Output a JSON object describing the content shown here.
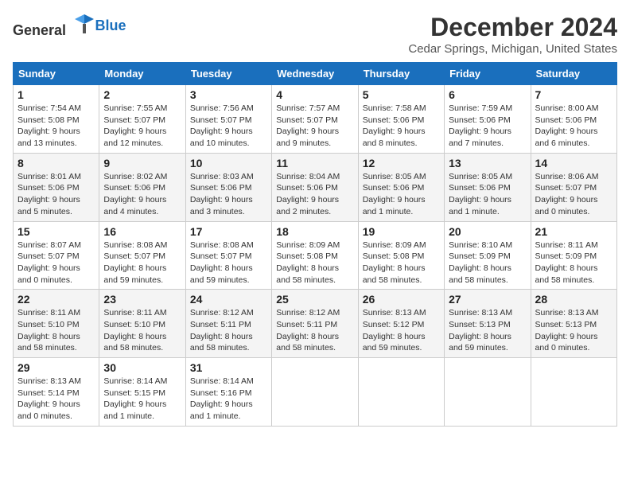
{
  "header": {
    "logo_general": "General",
    "logo_blue": "Blue",
    "month": "December 2024",
    "location": "Cedar Springs, Michigan, United States"
  },
  "days_of_week": [
    "Sunday",
    "Monday",
    "Tuesday",
    "Wednesday",
    "Thursday",
    "Friday",
    "Saturday"
  ],
  "weeks": [
    [
      {
        "day": "1",
        "sunrise": "Sunrise: 7:54 AM",
        "sunset": "Sunset: 5:08 PM",
        "daylight": "Daylight: 9 hours and 13 minutes."
      },
      {
        "day": "2",
        "sunrise": "Sunrise: 7:55 AM",
        "sunset": "Sunset: 5:07 PM",
        "daylight": "Daylight: 9 hours and 12 minutes."
      },
      {
        "day": "3",
        "sunrise": "Sunrise: 7:56 AM",
        "sunset": "Sunset: 5:07 PM",
        "daylight": "Daylight: 9 hours and 10 minutes."
      },
      {
        "day": "4",
        "sunrise": "Sunrise: 7:57 AM",
        "sunset": "Sunset: 5:07 PM",
        "daylight": "Daylight: 9 hours and 9 minutes."
      },
      {
        "day": "5",
        "sunrise": "Sunrise: 7:58 AM",
        "sunset": "Sunset: 5:06 PM",
        "daylight": "Daylight: 9 hours and 8 minutes."
      },
      {
        "day": "6",
        "sunrise": "Sunrise: 7:59 AM",
        "sunset": "Sunset: 5:06 PM",
        "daylight": "Daylight: 9 hours and 7 minutes."
      },
      {
        "day": "7",
        "sunrise": "Sunrise: 8:00 AM",
        "sunset": "Sunset: 5:06 PM",
        "daylight": "Daylight: 9 hours and 6 minutes."
      }
    ],
    [
      {
        "day": "8",
        "sunrise": "Sunrise: 8:01 AM",
        "sunset": "Sunset: 5:06 PM",
        "daylight": "Daylight: 9 hours and 5 minutes."
      },
      {
        "day": "9",
        "sunrise": "Sunrise: 8:02 AM",
        "sunset": "Sunset: 5:06 PM",
        "daylight": "Daylight: 9 hours and 4 minutes."
      },
      {
        "day": "10",
        "sunrise": "Sunrise: 8:03 AM",
        "sunset": "Sunset: 5:06 PM",
        "daylight": "Daylight: 9 hours and 3 minutes."
      },
      {
        "day": "11",
        "sunrise": "Sunrise: 8:04 AM",
        "sunset": "Sunset: 5:06 PM",
        "daylight": "Daylight: 9 hours and 2 minutes."
      },
      {
        "day": "12",
        "sunrise": "Sunrise: 8:05 AM",
        "sunset": "Sunset: 5:06 PM",
        "daylight": "Daylight: 9 hours and 1 minute."
      },
      {
        "day": "13",
        "sunrise": "Sunrise: 8:05 AM",
        "sunset": "Sunset: 5:06 PM",
        "daylight": "Daylight: 9 hours and 1 minute."
      },
      {
        "day": "14",
        "sunrise": "Sunrise: 8:06 AM",
        "sunset": "Sunset: 5:07 PM",
        "daylight": "Daylight: 9 hours and 0 minutes."
      }
    ],
    [
      {
        "day": "15",
        "sunrise": "Sunrise: 8:07 AM",
        "sunset": "Sunset: 5:07 PM",
        "daylight": "Daylight: 9 hours and 0 minutes."
      },
      {
        "day": "16",
        "sunrise": "Sunrise: 8:08 AM",
        "sunset": "Sunset: 5:07 PM",
        "daylight": "Daylight: 8 hours and 59 minutes."
      },
      {
        "day": "17",
        "sunrise": "Sunrise: 8:08 AM",
        "sunset": "Sunset: 5:07 PM",
        "daylight": "Daylight: 8 hours and 59 minutes."
      },
      {
        "day": "18",
        "sunrise": "Sunrise: 8:09 AM",
        "sunset": "Sunset: 5:08 PM",
        "daylight": "Daylight: 8 hours and 58 minutes."
      },
      {
        "day": "19",
        "sunrise": "Sunrise: 8:09 AM",
        "sunset": "Sunset: 5:08 PM",
        "daylight": "Daylight: 8 hours and 58 minutes."
      },
      {
        "day": "20",
        "sunrise": "Sunrise: 8:10 AM",
        "sunset": "Sunset: 5:09 PM",
        "daylight": "Daylight: 8 hours and 58 minutes."
      },
      {
        "day": "21",
        "sunrise": "Sunrise: 8:11 AM",
        "sunset": "Sunset: 5:09 PM",
        "daylight": "Daylight: 8 hours and 58 minutes."
      }
    ],
    [
      {
        "day": "22",
        "sunrise": "Sunrise: 8:11 AM",
        "sunset": "Sunset: 5:10 PM",
        "daylight": "Daylight: 8 hours and 58 minutes."
      },
      {
        "day": "23",
        "sunrise": "Sunrise: 8:11 AM",
        "sunset": "Sunset: 5:10 PM",
        "daylight": "Daylight: 8 hours and 58 minutes."
      },
      {
        "day": "24",
        "sunrise": "Sunrise: 8:12 AM",
        "sunset": "Sunset: 5:11 PM",
        "daylight": "Daylight: 8 hours and 58 minutes."
      },
      {
        "day": "25",
        "sunrise": "Sunrise: 8:12 AM",
        "sunset": "Sunset: 5:11 PM",
        "daylight": "Daylight: 8 hours and 58 minutes."
      },
      {
        "day": "26",
        "sunrise": "Sunrise: 8:13 AM",
        "sunset": "Sunset: 5:12 PM",
        "daylight": "Daylight: 8 hours and 59 minutes."
      },
      {
        "day": "27",
        "sunrise": "Sunrise: 8:13 AM",
        "sunset": "Sunset: 5:13 PM",
        "daylight": "Daylight: 8 hours and 59 minutes."
      },
      {
        "day": "28",
        "sunrise": "Sunrise: 8:13 AM",
        "sunset": "Sunset: 5:13 PM",
        "daylight": "Daylight: 9 hours and 0 minutes."
      }
    ],
    [
      {
        "day": "29",
        "sunrise": "Sunrise: 8:13 AM",
        "sunset": "Sunset: 5:14 PM",
        "daylight": "Daylight: 9 hours and 0 minutes."
      },
      {
        "day": "30",
        "sunrise": "Sunrise: 8:14 AM",
        "sunset": "Sunset: 5:15 PM",
        "daylight": "Daylight: 9 hours and 1 minute."
      },
      {
        "day": "31",
        "sunrise": "Sunrise: 8:14 AM",
        "sunset": "Sunset: 5:16 PM",
        "daylight": "Daylight: 9 hours and 1 minute."
      },
      null,
      null,
      null,
      null
    ]
  ]
}
